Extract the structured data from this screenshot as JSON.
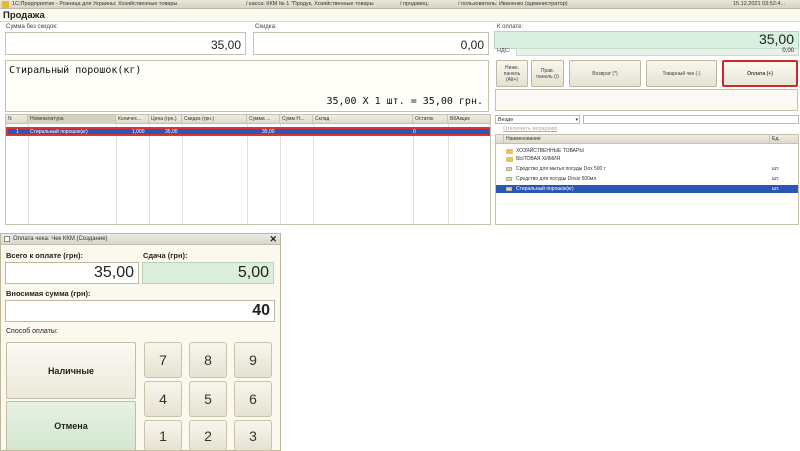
{
  "window": {
    "title": "1С:Предприятие - Розница для Украины: Хозяйственные товары",
    "kassa": "/ касса: ККМ № 1 \"Продук, Хозяйственные товары",
    "operator": "/ продавец:",
    "user": "/ пользователь:  Иваненко (администратор)",
    "datetime": "15.12.2021 03:52:4..."
  },
  "header": {
    "title": "Продажа"
  },
  "totals": {
    "sum_label": "Сумма без скидок:",
    "sum_value": "35,00",
    "discount_label": "Скидка:",
    "discount_value": "0,00",
    "pay_label": "К оплате:",
    "pay_value": "35,00",
    "vat_label": "НДС:",
    "vat_value": "0,00"
  },
  "item_display": {
    "name": "Стиральный порошок(кг)",
    "calc": "35,00  X 1 шт. = 35,00  грн."
  },
  "buttons": {
    "bottom_panel": "Нижн. панель (Alt+)",
    "right_panel": "Прав. панель (/)",
    "return": "Возврат (*)",
    "receipt": "Товарный чек (-)",
    "pay": "Оплата (+)"
  },
  "table": {
    "columns": [
      "N",
      "Номенклатура",
      "Количес...",
      "Цена (грн.)",
      "Скидка (грн.)",
      "Сумма ...",
      "Сумм Н...",
      "Склад",
      "Остаток",
      "ВКАкциз"
    ],
    "rows": [
      {
        "n": "1",
        "name": "Стиральный порошок(кг)",
        "qty": "1,000",
        "price": "35,00",
        "discount": "",
        "sum": "35,00",
        "sum_n": "",
        "warehouse": "",
        "stock": "0",
        "excise": ""
      }
    ]
  },
  "catalog": {
    "filter_value": "Везде",
    "search_placeholder": "",
    "link": "Отключить иерархию",
    "col_name": "Наименование",
    "col_unit": "Ед.",
    "rows": [
      {
        "name": "ХОЗЯЙСТВЕННЫЕ ТОВАРЫ",
        "unit": "",
        "type": "folder"
      },
      {
        "name": "БЫТОВАЯ ХИМИЯ",
        "unit": "",
        "type": "folder"
      },
      {
        "name": "Средство для мытья посуды Dox 500 г",
        "unit": "шт.",
        "type": "item"
      },
      {
        "name": "Средство для посуды Dosis 500мл",
        "unit": "шт.",
        "type": "item"
      },
      {
        "name": "Стиральный порошок(кг)",
        "unit": "шт.",
        "type": "item",
        "selected": true
      }
    ]
  },
  "dialog": {
    "title": "Оплата чека: Чек ККМ (Создание)",
    "total_label": "Всего к оплате (грн):",
    "total_value": "35,00",
    "change_label": "Сдача (грн):",
    "change_value": "5,00",
    "input_label": "Вносимая сумма (грн):",
    "input_value": "40",
    "method_label": "Способ оплаты:",
    "cash_button": "Наличные",
    "cancel_button": "Отмена",
    "keys": [
      "7",
      "8",
      "9",
      "4",
      "5",
      "6",
      "1",
      "2",
      "3"
    ]
  },
  "colors": {
    "selection": "#2a56b5",
    "highlight_border": "#e03030",
    "pay_bg": "#d9efdf"
  }
}
